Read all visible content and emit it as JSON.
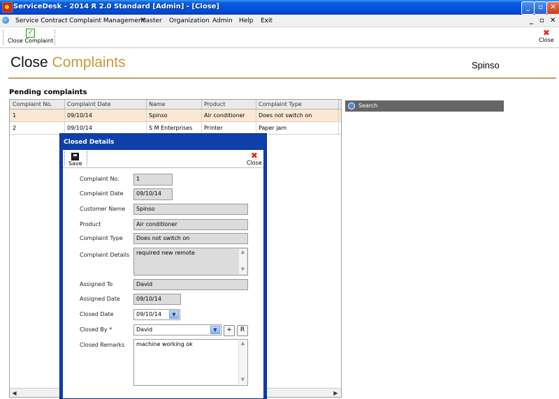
{
  "window": {
    "title": "ServiceDesk - 2014 R 2.0 Standard [Admin] - [Close]"
  },
  "menu": {
    "items": [
      "Service Contract",
      "Complaint Management",
      "Master",
      "Organization",
      "Admin",
      "Help",
      "Exit"
    ]
  },
  "toolbar": {
    "close_complaint": "Close Complaint",
    "close": "Close"
  },
  "page": {
    "title_word1": "Close",
    "title_word2": "Complaints",
    "company": "Spinso",
    "accent": "#c89a3a"
  },
  "pending": {
    "title": "Pending complaints",
    "columns": [
      "Complaint No.",
      "Complaint Date",
      "Name",
      "Product",
      "Complaint Type"
    ],
    "rows": [
      [
        "1",
        "09/10/14",
        "Spinso",
        "Air conditioner",
        "Does not switch on"
      ],
      [
        "2",
        "09/10/14",
        "S M Enterprises",
        "Printer",
        "Paper jam"
      ]
    ]
  },
  "search": {
    "label": "Search"
  },
  "dialog": {
    "title": "Closed Details",
    "save": "Save",
    "close": "Close",
    "labels": {
      "complaint_no": "Complaint No.",
      "complaint_date": "Complaint Date",
      "customer_name": "Customer Name",
      "product": "Product",
      "complaint_type": "Complaint Type",
      "complaint_details": "Complaint Details",
      "assigned_to": "Assigned To",
      "assigned_date": "Assigned Date",
      "closed_date": "Closed Date",
      "closed_by": "Closed By *",
      "closed_remarks": "Closed Remarks"
    },
    "values": {
      "complaint_no": "1",
      "complaint_date": "09/10/14",
      "customer_name": "Spinso",
      "product": "Air conditioner",
      "complaint_type": "Does not switch on",
      "complaint_details": "required new remote",
      "assigned_to": "David",
      "assigned_date": "09/10/14",
      "closed_date": "09/10/14",
      "closed_by": "David",
      "closed_remarks": "machine working ok"
    },
    "add_button": "+",
    "refresh_button": "R"
  }
}
